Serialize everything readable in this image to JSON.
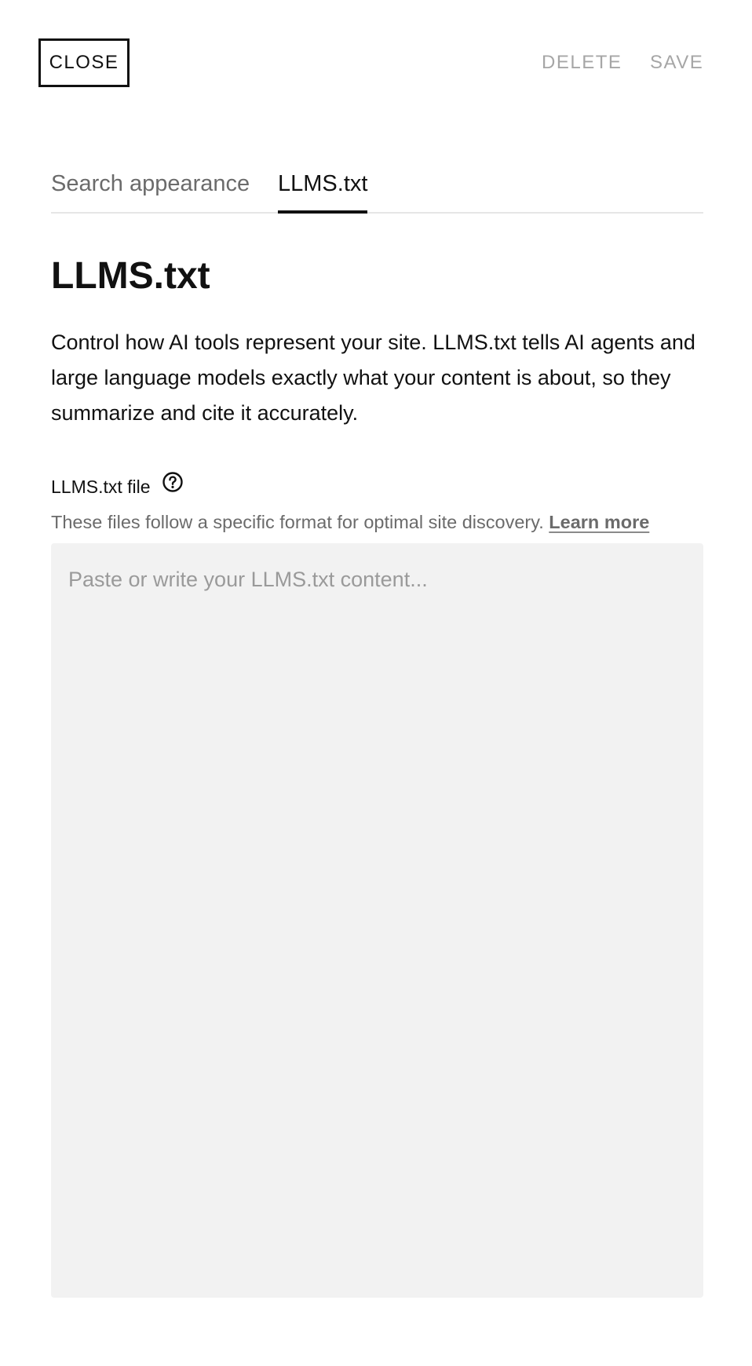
{
  "header": {
    "close_label": "CLOSE",
    "delete_label": "DELETE",
    "save_label": "SAVE"
  },
  "tabs": [
    {
      "label": "Search appearance",
      "active": false
    },
    {
      "label": "LLMS.txt",
      "active": true
    }
  ],
  "main": {
    "title": "LLMS.txt",
    "description": "Control how AI tools represent your site. LLMS.txt tells AI agents and large language models exactly what your content is about, so they summarize and cite it accurately.",
    "field": {
      "label": "LLMS.txt file",
      "help_icon": "question-circle-icon",
      "hint": "These files follow a specific format for optimal site discovery.",
      "learn_more": "Learn more",
      "value": "",
      "placeholder": "Paste or write your LLMS.txt content..."
    }
  },
  "colors": {
    "text": "#111111",
    "muted": "#6b6b6b",
    "disabled": "#a6a6a6",
    "editor_bg": "#f2f2f2",
    "divider": "#e6e6e6"
  }
}
